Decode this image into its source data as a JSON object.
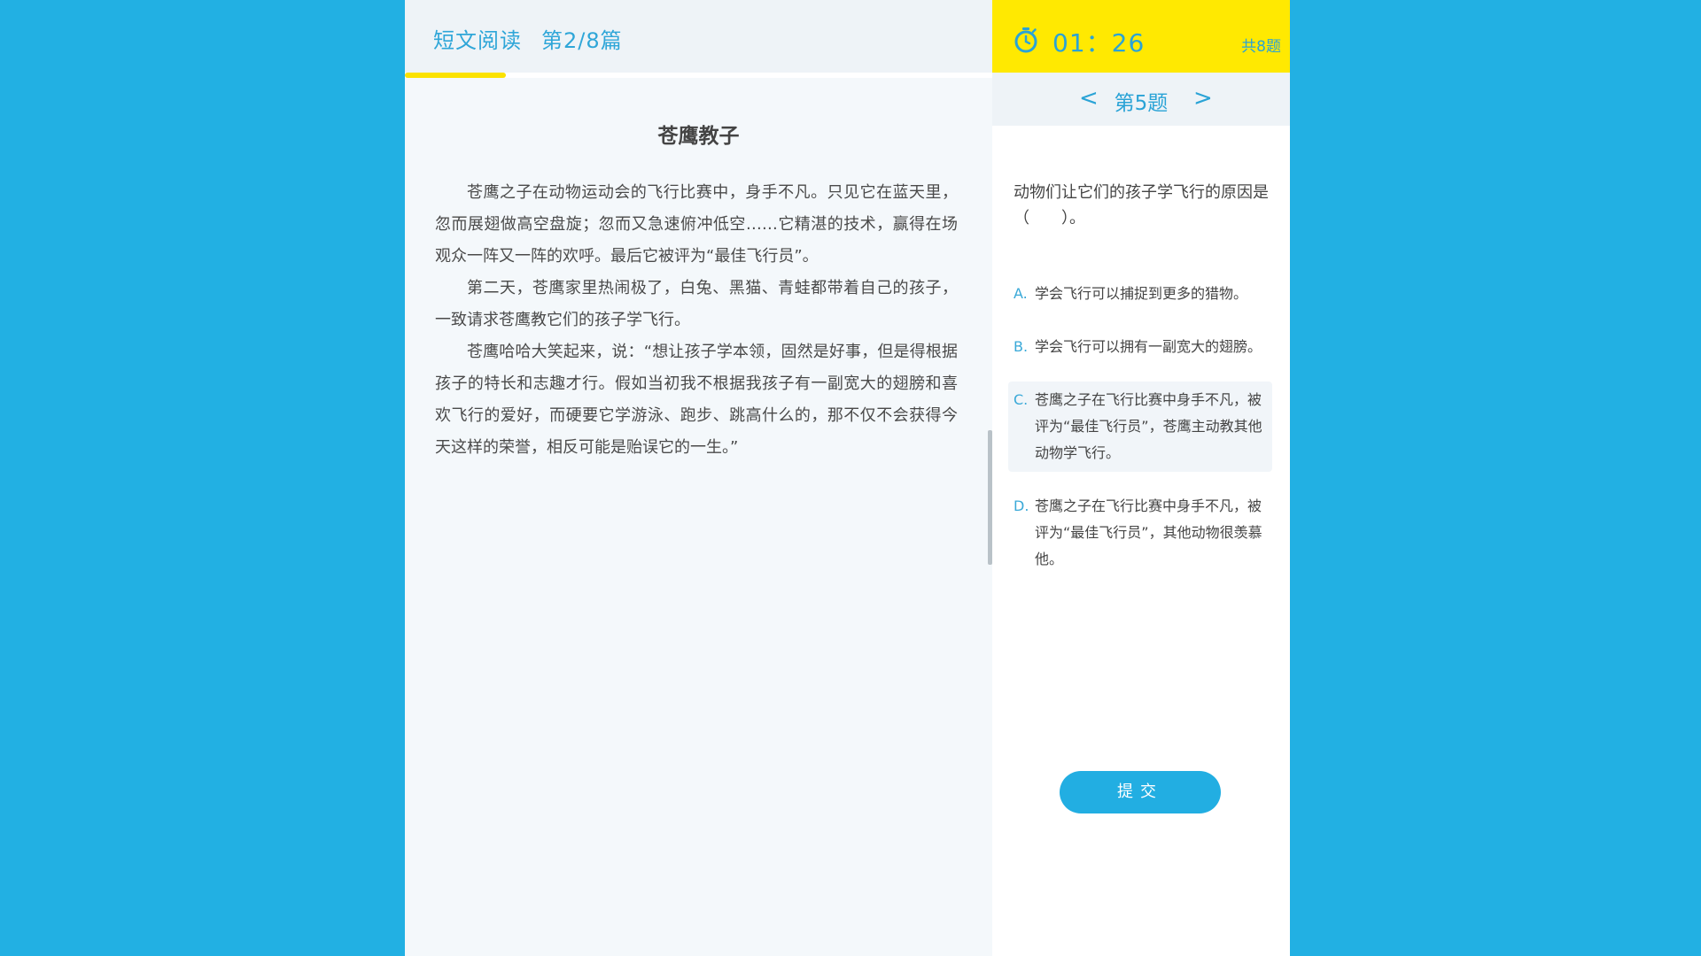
{
  "header": {
    "section": "短文阅读",
    "article_index": "第2/8篇",
    "reading_progress": 0.172
  },
  "timer": {
    "time": "01：26",
    "total": "共8题"
  },
  "nav": {
    "prev": "<",
    "label": "第5题",
    "next": ">"
  },
  "article": {
    "title": "苍鹰教子",
    "paragraphs": [
      "苍鹰之子在动物运动会的飞行比赛中，身手不凡。只见它在蓝天里，忽而展翅做高空盘旋；忽而又急速俯冲低空……它精湛的技术，赢得在场观众一阵又一阵的欢呼。最后它被评为“最佳飞行员”。",
      "第二天，苍鹰家里热闹极了，白兔、黑猫、青蛙都带着自己的孩子，一致请求苍鹰教它们的孩子学飞行。",
      "苍鹰哈哈大笑起来，说：“想让孩子学本领，固然是好事，但是得根据孩子的特长和志趣才行。假如当初我不根据我孩子有一副宽大的翅膀和喜欢飞行的爱好，而硬要它学游泳、跑步、跳高什么的，那不仅不会获得今天这样的荣誉，相反可能是贻误它的一生。”"
    ]
  },
  "question": {
    "text": "动物们让它们的孩子学飞行的原因是（　　）。",
    "options": [
      {
        "letter": "A.",
        "text": "学会飞行可以捕捉到更多的猎物。"
      },
      {
        "letter": "B.",
        "text": "学会飞行可以拥有一副宽大的翅膀。"
      },
      {
        "letter": "C.",
        "text": "苍鹰之子在飞行比赛中身手不凡，被评为“最佳飞行员”，苍鹰主动教其他动物学飞行。"
      },
      {
        "letter": "D.",
        "text": "苍鹰之子在飞行比赛中身手不凡，被评为“最佳飞行员”，其他动物很羡慕他。"
      }
    ],
    "selected": "C"
  },
  "submit_label": "提交",
  "colors": {
    "background": "#22b0e3",
    "accent": "#2aa3d6",
    "timer_bar": "#ffe901",
    "progress": "#fbe200"
  }
}
